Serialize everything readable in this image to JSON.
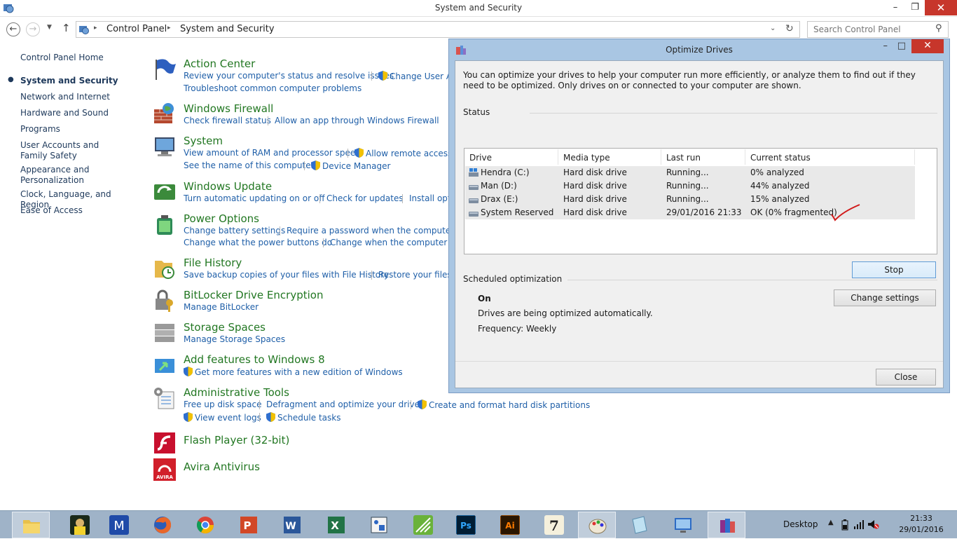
{
  "window": {
    "title": "System and Security"
  },
  "address": {
    "crumbs": [
      "Control Panel",
      "System and Security"
    ],
    "search_placeholder": "Search Control Panel"
  },
  "leftnav": {
    "items": [
      "Control Panel Home",
      "System and Security",
      "Network and Internet",
      "Hardware and Sound",
      "Programs",
      "User Accounts and Family Safety",
      "Appearance and Personalization",
      "Clock, Language, and Region",
      "Ease of Access"
    ]
  },
  "categories": {
    "action_center": {
      "title": "Action Center",
      "l1": "Review your computer's status and resolve issues",
      "l2": "Change User Ac",
      "l3": "Troubleshoot common computer problems"
    },
    "firewall": {
      "title": "Windows Firewall",
      "l1": "Check firewall status",
      "l2": "Allow an app through Windows Firewall"
    },
    "system": {
      "title": "System",
      "l1": "View amount of RAM and processor speed",
      "l2": "Allow remote access",
      "l3": "See the name of this computer",
      "l4": "Device Manager"
    },
    "update": {
      "title": "Windows Update",
      "l1": "Turn automatic updating on or off",
      "l2": "Check for updates",
      "l3": "Install opti"
    },
    "power": {
      "title": "Power Options",
      "l1": "Change battery settings",
      "l2": "Require a password when the computer wak",
      "l3": "Change what the power buttons do",
      "l4": "Change when the computer slee"
    },
    "history": {
      "title": "File History",
      "l1": "Save backup copies of your files with File History",
      "l2": "Restore your files w"
    },
    "bitlocker": {
      "title": "BitLocker Drive Encryption",
      "l1": "Manage BitLocker"
    },
    "storage": {
      "title": "Storage Spaces",
      "l1": "Manage Storage Spaces"
    },
    "addfeatures": {
      "title": "Add features to Windows 8",
      "l1": "Get more features with a new edition of Windows"
    },
    "admin": {
      "title": "Administrative Tools",
      "l1": "Free up disk space",
      "l2": "Defragment and optimize your drives",
      "l3": "Create and format hard disk partitions",
      "l4": "View event logs",
      "l5": "Schedule tasks"
    },
    "flash": {
      "title": "Flash Player (32-bit)"
    },
    "avira": {
      "title": "Avira Antivirus",
      "logo_text": "AVIRA"
    }
  },
  "dialog": {
    "title": "Optimize Drives",
    "intro": "You can optimize your drives to help your computer run more efficiently, or analyze them to find out if they need to be optimized. Only drives on or connected to your computer are shown.",
    "status_label": "Status",
    "columns": [
      "Drive",
      "Media type",
      "Last run",
      "Current status"
    ],
    "drives": [
      {
        "drive": "Hendra (C:)",
        "media": "Hard disk drive",
        "last_run": "Running...",
        "status": "0% analyzed"
      },
      {
        "drive": "Man (D:)",
        "media": "Hard disk drive",
        "last_run": "Running...",
        "status": "44% analyzed"
      },
      {
        "drive": "Drax (E:)",
        "media": "Hard disk drive",
        "last_run": "Running...",
        "status": "15% analyzed"
      },
      {
        "drive": "System Reserved",
        "media": "Hard disk drive",
        "last_run": "29/01/2016 21:33",
        "status": "OK (0% fragmented)"
      }
    ],
    "stop_label": "Stop",
    "scheduled_label": "Scheduled optimization",
    "sched_state": "On",
    "sched_desc": "Drives are being optimized automatically.",
    "sched_freq": "Frequency: Weekly",
    "change_settings_label": "Change settings",
    "close_label": "Close"
  },
  "taskbar": {
    "apps": [
      "file-explorer",
      "pes-game",
      "m-app",
      "firefox",
      "chrome",
      "powerpoint",
      "word",
      "excel",
      "app-blue",
      "app-green",
      "photoshop",
      "illustrator",
      "7zip",
      "paint",
      "notes",
      "remote-app",
      "winrar"
    ],
    "desktop_label": "Desktop",
    "time": "21:33",
    "date": "29/01/2016"
  },
  "colors": {
    "link": "#1f5fa8",
    "heading": "#227722",
    "close_red": "#c7362b",
    "taskbar": "#9fb3c8"
  }
}
